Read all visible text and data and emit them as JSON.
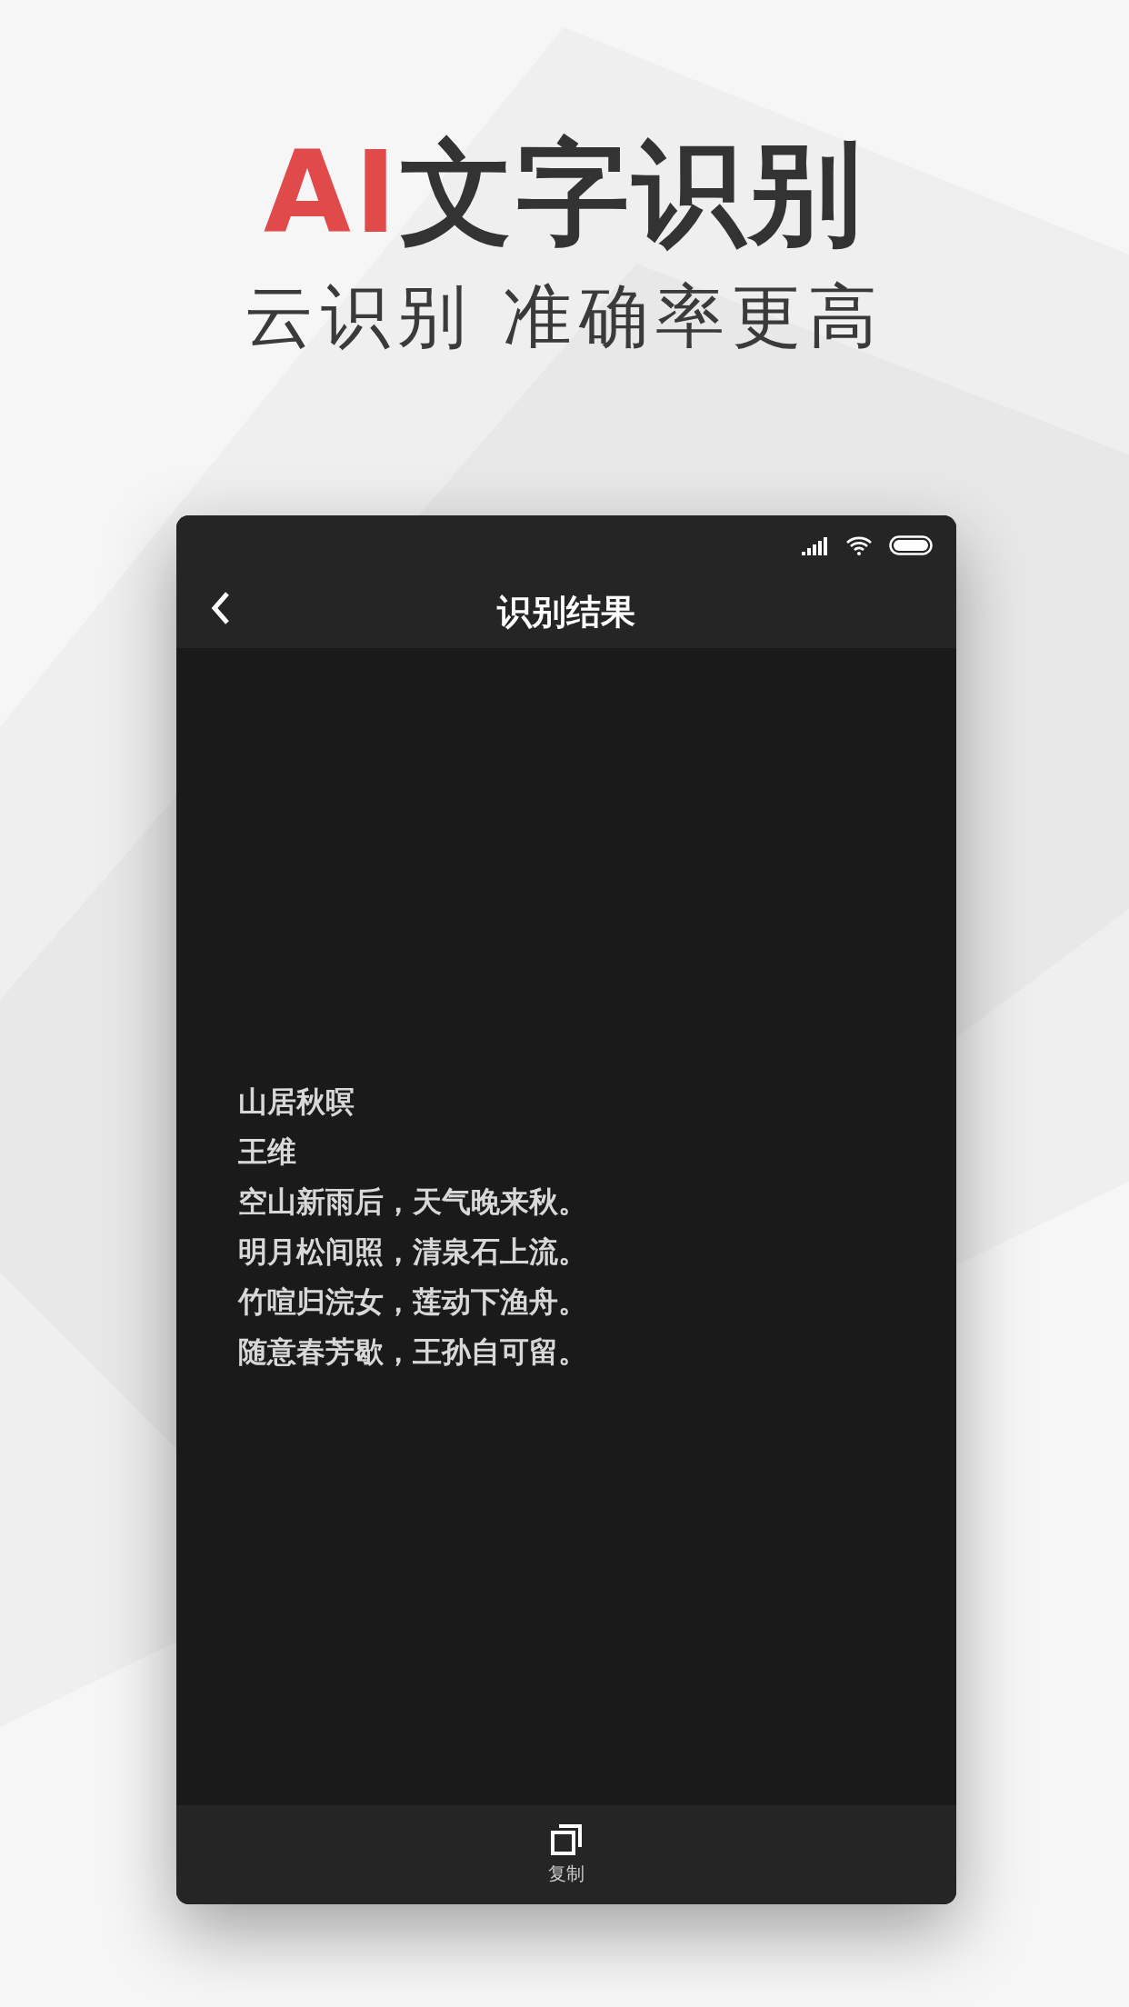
{
  "headline": {
    "accent": "AI",
    "text": "文字识别"
  },
  "subheadline": "云识别 准确率更高",
  "phone": {
    "title": "识别结果",
    "lines": [
      "山居秋暝",
      "王维",
      "空山新雨后，天气晚来秋。",
      "明月松间照，清泉石上流。",
      "竹喧归浣女，莲动下渔舟。",
      "随意春芳歇，王孙自可留。"
    ],
    "toolbar": [
      {
        "label": "复制"
      }
    ]
  }
}
